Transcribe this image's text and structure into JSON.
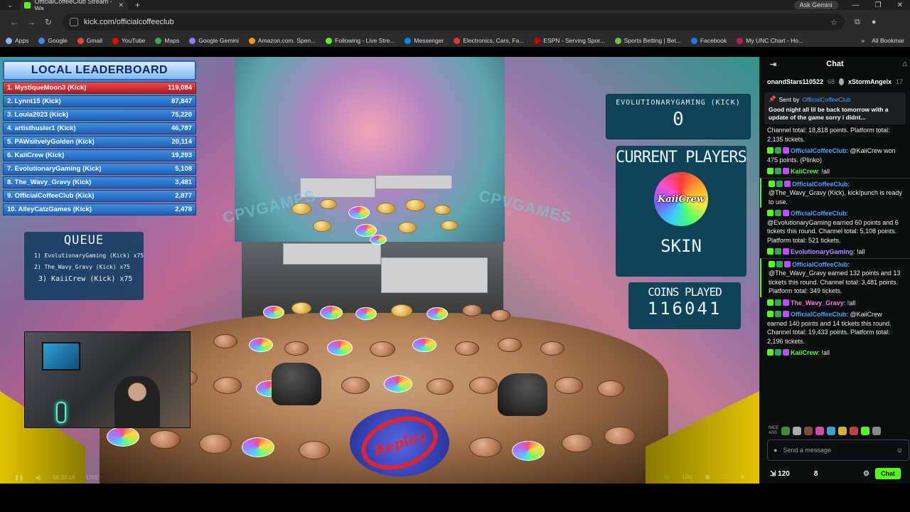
{
  "browser": {
    "tab_title": "OfficialCoffeeClub Stream - Wa",
    "tab_close": "✕",
    "new_tab": "+",
    "tab_menu": "⌄",
    "gemini_button": "Ask Gemini",
    "window_controls": [
      "—",
      "❐",
      "✕"
    ],
    "url": "kick.com/officialcoffeeclub",
    "bookmarks": [
      {
        "label": "Apps",
        "color": "#8ab4f8"
      },
      {
        "label": "Google",
        "color": "#4285f4"
      },
      {
        "label": "Gmail",
        "color": "#ea4335"
      },
      {
        "label": "YouTube",
        "color": "#ff0000"
      },
      {
        "label": "Maps",
        "color": "#34a853"
      },
      {
        "label": "Google Gemini",
        "color": "#8e7cff"
      },
      {
        "label": "Amazon.com. Spen...",
        "color": "#ff9900"
      },
      {
        "label": "Following - Live Stre...",
        "color": "#53fc18"
      },
      {
        "label": "Messenger",
        "color": "#0084ff"
      },
      {
        "label": "Electronics, Cars, Fa...",
        "color": "#e53238"
      },
      {
        "label": "ESPN - Serving Spor...",
        "color": "#cc0000"
      },
      {
        "label": "Sports Betting | Bet...",
        "color": "#6cc04a"
      },
      {
        "label": "Facebook",
        "color": "#1877f2"
      },
      {
        "label": "My UNC Chart - Ho...",
        "color": "#c2185b"
      }
    ],
    "bookmarks_more": "»",
    "all_bookmarks": "All Bookmar"
  },
  "leaderboard": {
    "title": "LOCAL LEADERBOARD",
    "rows": [
      {
        "name": "1. MystiqueMoon3 (Kick)",
        "points": "119,084"
      },
      {
        "name": "2. Lynnt15 (Kick)",
        "points": "87,847"
      },
      {
        "name": "3. Loula2023 (Kick)",
        "points": "75,220"
      },
      {
        "name": "4. artisthusler1 (Kick)",
        "points": "46,787"
      },
      {
        "name": "5. PAWsitvelyGolden (Kick)",
        "points": "20,114"
      },
      {
        "name": "6. KaiiCrew (Kick)",
        "points": "19,293"
      },
      {
        "name": "7. EvolutionaryGaming (Kick)",
        "points": "5,108"
      },
      {
        "name": "8. The_Wavy_Gravy (Kick)",
        "points": "3,481"
      },
      {
        "name": "9. OfficialCoffeeClub (Kick)",
        "points": "2,877"
      },
      {
        "name": "10. AlleyCatzGames (Kick)",
        "points": "2,478"
      }
    ]
  },
  "queue": {
    "title": "QUEUE",
    "items": [
      "1) EvolutionaryGaming (Kick) x75",
      "2) The_Wavy_Gravy (Kick) x75",
      "3) KaiiCrew (Kick) x75"
    ]
  },
  "game": {
    "side_text": "CPVGAMES",
    "replay_label": "Replay",
    "evo_name": "EVOLUTIONARYGAMING (KICK)",
    "evo_count": "0",
    "current_players_title": "CURRENT PLAYERS",
    "player_avatar_text": "KaiiCrew",
    "skin_label": "SKIN",
    "coins_played_title": "COINS PLAYED",
    "coins_played_value": "116041"
  },
  "player_controls": {
    "time": "08:33:18",
    "live": "LIVE",
    "clip": "Clip"
  },
  "chat": {
    "title": "Chat",
    "gifters": [
      {
        "name": "onandStars110522",
        "count": "68"
      },
      {
        "name": "xStormAngelx",
        "count": "17"
      }
    ],
    "pinned": {
      "sent_by_label": "Sent by",
      "sender": "OfficialCoffeeClub",
      "text": "Good night all lil be back tomorrow with a update of the game sorry i didnt..."
    },
    "messages": [
      {
        "user": "",
        "user_class": "",
        "text": "Channel total: 18,818 points. Platform total: 2,135 tickets.",
        "hl": false
      },
      {
        "user": "OfficialCoffeeClub",
        "user_class": "u-blue",
        "text": ": @KaiiCrew won 475 points. (Plinko)",
        "hl": false
      },
      {
        "user": "KaiiCrew",
        "user_class": "u-green",
        "text": ": !all",
        "hl": false
      },
      {
        "user": "OfficialCoffeeClub",
        "user_class": "u-blue",
        "text": ": @The_Wavy_Gravy (Kick), kick/punch is ready to use.",
        "hl": true
      },
      {
        "user": "OfficialCoffeeClub",
        "user_class": "u-blue",
        "text": ": @EvolutionaryGaming earned 60 points and 6 tickets this round. Channel total: 5,108 points. Platform total: 521 tickets.",
        "hl": false
      },
      {
        "user": "EvolutionaryGaming",
        "user_class": "u-purple",
        "text": ": !all",
        "hl": false
      },
      {
        "user": "OfficialCoffeeClub",
        "user_class": "u-blue",
        "text": ": @The_Wavy_Gravy earned 132 points and 13 tickets this round. Channel total: 3,481 points. Platform total: 349 tickets.",
        "hl": true
      },
      {
        "user": "The_Wavy_Gravy",
        "user_class": "u-pink",
        "text": ": !all",
        "hl": false
      },
      {
        "user": "OfficialCoffeeClub",
        "user_class": "u-blue",
        "text": ": @KaiiCrew earned 140 points and 14 tickets this round. Channel total: 19,433 points. Platform total: 2,196 tickets.",
        "hl": false
      },
      {
        "user": "KaiiCrew",
        "user_class": "u-green",
        "text": ": !all",
        "hl": false
      }
    ],
    "emote_label": "NICE ASS",
    "input_placeholder": "Send a message",
    "kicks_count": "120",
    "viewers_count": "8",
    "send_button": "Chat"
  },
  "colors": {
    "kick_green": "#53fc18",
    "leaderboard_blue": "#1f60b8",
    "leaderboard_red": "#b81818",
    "overlay_teal": "#0f4458",
    "replay_red": "#e4242c"
  }
}
